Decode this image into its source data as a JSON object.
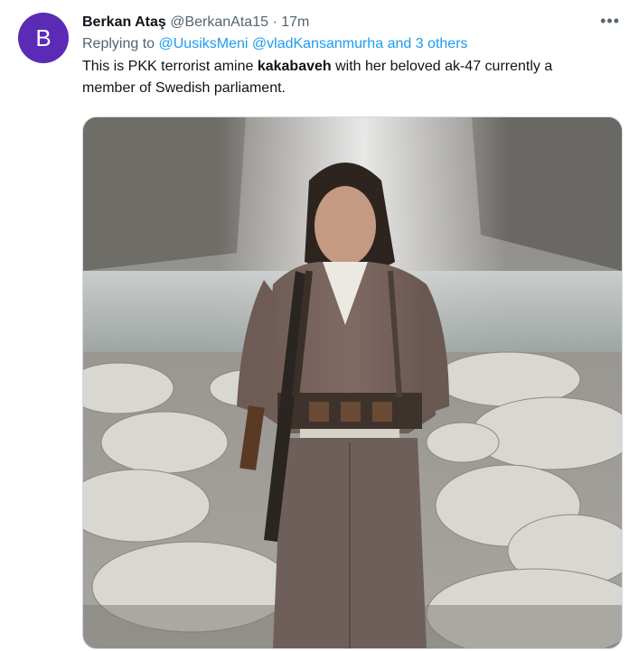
{
  "tweet": {
    "avatar_letter": "B",
    "display_name": "Berkan Ataş",
    "handle": "@BerkanAta15",
    "separator": "·",
    "time": "17m",
    "more_icon": "more-horizontal-icon",
    "reply": {
      "prefix": "Replying to",
      "mentions": [
        "@UusiksMeni",
        "@vladKansanmurha",
        "and 3 others"
      ]
    },
    "text": {
      "before": "This is PKK terrorist amine ",
      "bold": "kakabaveh",
      "after": " with her beloved ak-47 currently a member of Swedish parliament."
    },
    "media": {
      "kind": "photo"
    }
  },
  "colors": {
    "accent": "#1d9bf0",
    "avatar_bg": "#5b2bb5",
    "secondary_text": "#536471"
  }
}
